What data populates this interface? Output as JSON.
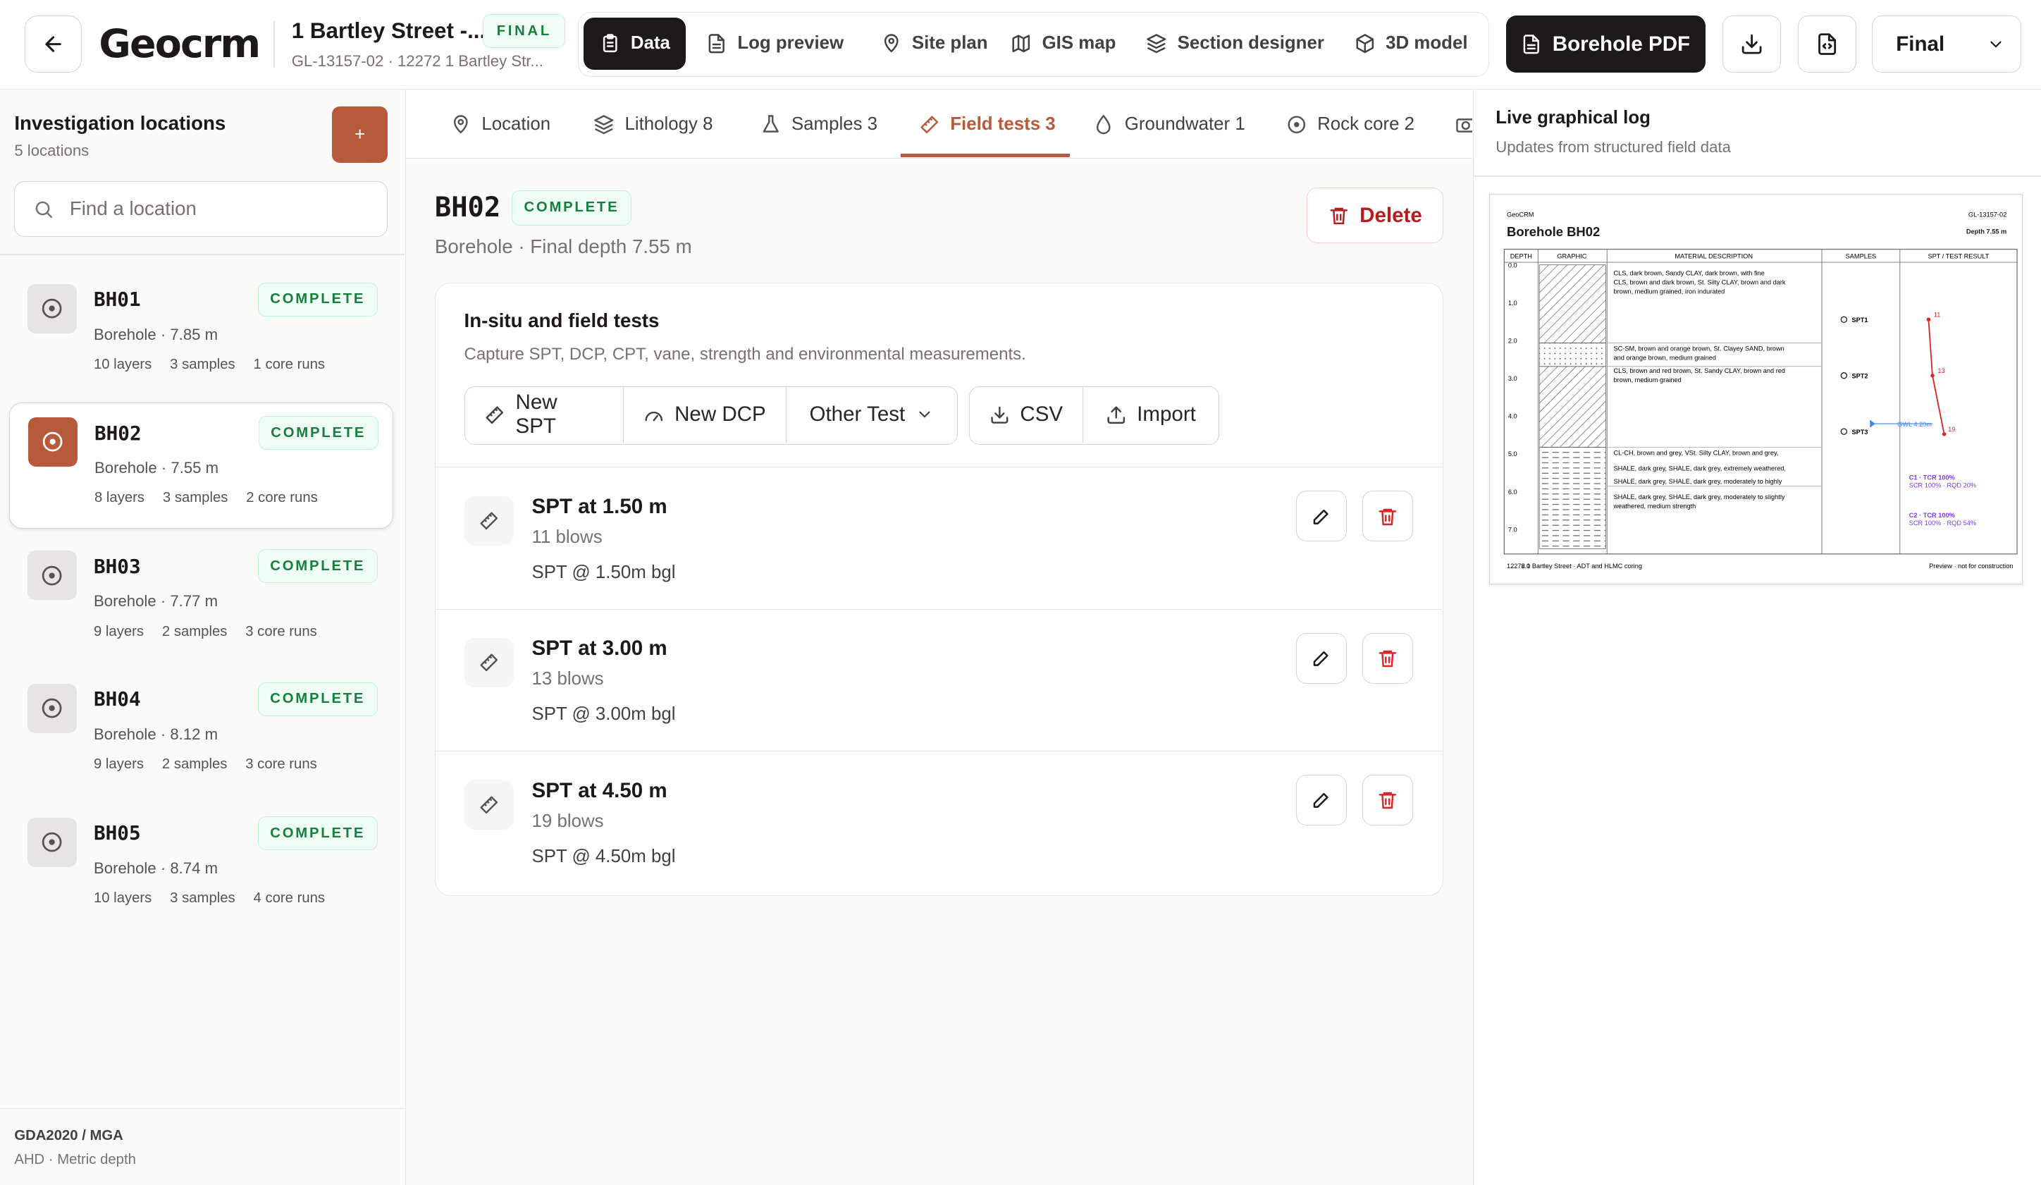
{
  "header": {
    "logo": "Geocrm",
    "project_title": "1 Bartley Street -...",
    "project_sub": "GL-13157-02 · 12272 1 Bartley Str...",
    "status_badge": "FINAL",
    "nav": [
      {
        "label": "Data",
        "icon": "clipboard-icon",
        "active": true
      },
      {
        "label": "Log preview",
        "icon": "document-icon"
      },
      {
        "label": "Site plan",
        "icon": "map-pin-icon"
      },
      {
        "label": "GIS map",
        "icon": "map-icon"
      },
      {
        "label": "Section designer",
        "icon": "layers-icon"
      },
      {
        "label": "3D model",
        "icon": "cube-icon"
      }
    ],
    "pdf_button": "Borehole PDF",
    "status_select": "Final"
  },
  "sidebar": {
    "title": "Investigation locations",
    "count": "5 locations",
    "add_button": "+",
    "search_placeholder": "Find a location",
    "locations": [
      {
        "name": "BH01",
        "badge": "COMPLETE",
        "type": "Borehole · 7.85 m",
        "layers": "10 layers",
        "samples": "3 samples",
        "cores": "1 core runs"
      },
      {
        "name": "BH02",
        "badge": "COMPLETE",
        "type": "Borehole · 7.55 m",
        "layers": "8 layers",
        "samples": "3 samples",
        "cores": "2 core runs"
      },
      {
        "name": "BH03",
        "badge": "COMPLETE",
        "type": "Borehole · 7.77 m",
        "layers": "9 layers",
        "samples": "2 samples",
        "cores": "3 core runs"
      },
      {
        "name": "BH04",
        "badge": "COMPLETE",
        "type": "Borehole · 8.12 m",
        "layers": "9 layers",
        "samples": "2 samples",
        "cores": "3 core runs"
      },
      {
        "name": "BH05",
        "badge": "COMPLETE",
        "type": "Borehole · 8.74 m",
        "layers": "10 layers",
        "samples": "3 samples",
        "cores": "4 core runs"
      }
    ],
    "footer_line1": "GDA2020 / MGA",
    "footer_line2": "AHD · Metric depth"
  },
  "main": {
    "tabs": [
      {
        "label": "Location",
        "icon": "map-pin-icon"
      },
      {
        "label": "Lithology 8",
        "icon": "layers-icon"
      },
      {
        "label": "Samples 3",
        "icon": "flask-icon"
      },
      {
        "label": "Field tests 3",
        "icon": "ruler-icon",
        "active": true
      },
      {
        "label": "Groundwater 1",
        "icon": "droplet-icon"
      },
      {
        "label": "Rock core 2",
        "icon": "target-icon"
      }
    ],
    "title": "BH02",
    "badge": "COMPLETE",
    "subtitle": "Borehole · Final depth 7.55 m",
    "delete_button": "Delete",
    "card": {
      "title": "In-situ and field tests",
      "subtitle": "Capture SPT, DCP, CPT, vane, strength and environmental measurements.",
      "buttons": {
        "new_spt": "New SPT",
        "new_dcp": "New DCP",
        "other_test": "Other Test",
        "csv": "CSV",
        "import": "Import"
      },
      "tests": [
        {
          "title": "SPT at 1.50 m",
          "blows": "11 blows",
          "note": "SPT @ 1.50m bgl"
        },
        {
          "title": "SPT at 3.00 m",
          "blows": "13 blows",
          "note": "SPT @ 3.00m bgl"
        },
        {
          "title": "SPT at 4.50 m",
          "blows": "19 blows",
          "note": "SPT @ 4.50m bgl"
        }
      ]
    }
  },
  "right_panel": {
    "title": "Live graphical log",
    "subtitle": "Updates from structured field data",
    "log": {
      "brand": "GeoCRM",
      "project_no": "GL-13157-02",
      "title": "Borehole BH02",
      "depth": "Depth 7.55 m",
      "columns": [
        "DEPTH",
        "GRAPHIC",
        "MATERIAL DESCRIPTION",
        "SAMPLES",
        "SPT / TEST RESULT"
      ],
      "depth_ticks": [
        "0.0",
        "1.0",
        "2.0",
        "3.0",
        "4.0",
        "5.0",
        "6.0",
        "7.0"
      ],
      "descriptions": [
        "CLS, dark brown, Sandy CLAY, dark brown, with fine",
        "CLS, brown and dark brown, St. Silty CLAY, brown and dark",
        "brown, medium grained, iron indurated",
        "SC-SM, brown and orange brown, St. Clayey SAND, brown",
        "and orange brown, medium grained",
        "CLS, brown and red brown, St. Sandy CLAY, brown and red",
        "brown, medium grained",
        "CL-CH, brown and grey, VSt. Silty CLAY, brown and grey,",
        "SHALE, dark grey, SHALE, dark grey, extremely weathered,",
        "SHALE, dark grey, SHALE, dark grey, moderately to highly",
        "SHALE, dark grey, SHALE, dark grey, moderately to slightly",
        "weathered, medium strength"
      ],
      "samples": [
        "SPT1",
        "SPT2",
        "SPT3"
      ],
      "spt_values": [
        "11",
        "13",
        "19"
      ],
      "water_label": "GWL 4.20m",
      "core1a": "C1 · TCR 100%",
      "core1b": "SCR 100% · RQD 20%",
      "core2a": "C2 · TCR 100%",
      "core2b": "SCR 100% · RQD 54%",
      "footer_left": "12272 1 Bartley Street · ADT and HLMC coring",
      "footer_right": "Preview · not for construction",
      "footer_depth": "8.0"
    }
  }
}
